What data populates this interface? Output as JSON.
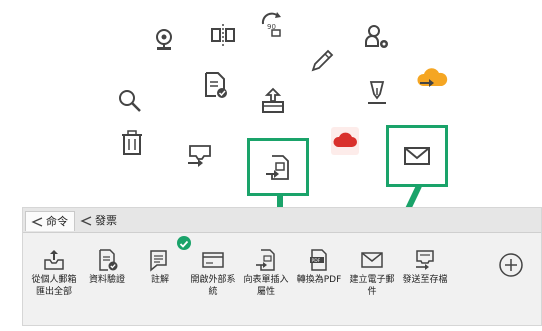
{
  "colors": {
    "accent_green": "#1aa36a",
    "icon_gray": "#444444",
    "cloud_red": "#d9302c",
    "cloud_orange": "#f5a623"
  },
  "tabs": [
    {
      "label": "命令",
      "icon": "share-icon",
      "active": true
    },
    {
      "label": "發票",
      "icon": "share-icon",
      "active": false
    }
  ],
  "tools": [
    {
      "label": "從個人郵箱匯出全部",
      "icon": "export-mail-icon"
    },
    {
      "label": "資料驗證",
      "icon": "verify-icon"
    },
    {
      "label": "註解",
      "icon": "comment-icon"
    },
    {
      "label": "開啟外部系統",
      "icon": "external-system-icon"
    },
    {
      "label": "向表單插入屬性",
      "icon": "insert-attribute-icon"
    },
    {
      "label": "轉換為PDF",
      "icon": "pdf-icon"
    },
    {
      "label": "建立電子郵件",
      "icon": "email-icon"
    },
    {
      "label": "發送至存檔",
      "icon": "archive-icon"
    }
  ],
  "add_button": {
    "icon": "plus-circle-icon"
  }
}
